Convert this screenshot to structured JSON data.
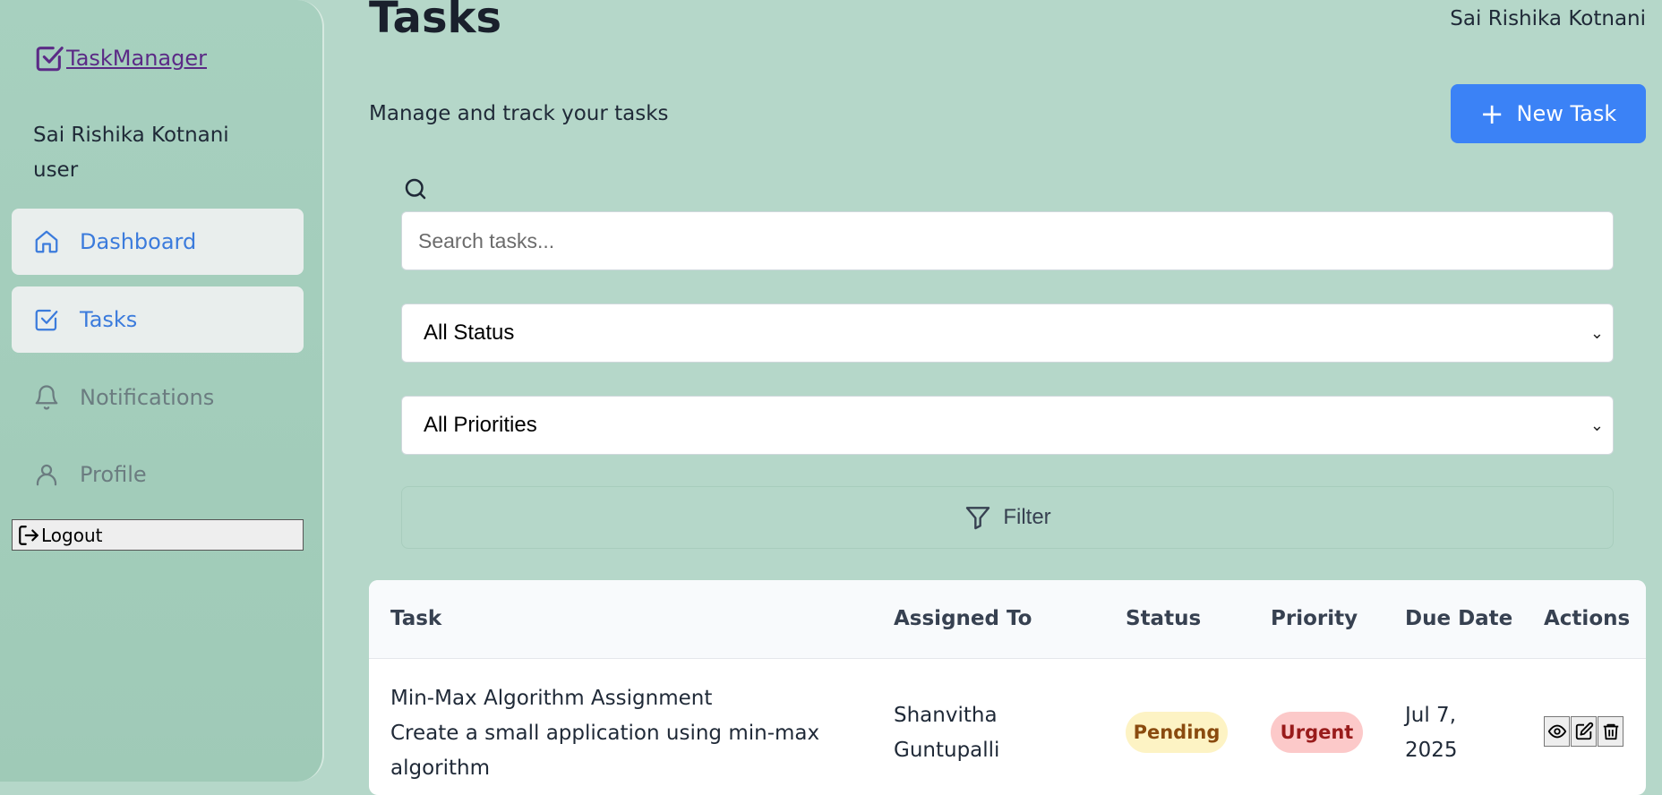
{
  "brand": {
    "name": "TaskManager"
  },
  "user": {
    "name": "Sai Rishika Kotnani",
    "role": "user"
  },
  "nav": [
    {
      "label": "Dashboard",
      "icon": "home-icon"
    },
    {
      "label": "Tasks",
      "icon": "checkbox-icon"
    },
    {
      "label": "Notifications",
      "icon": "bell-icon"
    },
    {
      "label": "Profile",
      "icon": "user-icon"
    }
  ],
  "logout": {
    "label": "Logout"
  },
  "header": {
    "title": "Tasks",
    "user_name": "Sai Rishika Kotnani",
    "subtitle": "Manage and track your tasks",
    "new_task_label": "New Task"
  },
  "search": {
    "placeholder": "Search tasks..."
  },
  "filters": {
    "status_selected": "All Status",
    "priority_selected": "All Priorities",
    "filter_label": "Filter"
  },
  "table": {
    "columns": [
      "Task",
      "Assigned To",
      "Status",
      "Priority",
      "Due Date",
      "Actions"
    ],
    "rows": [
      {
        "title": "Min-Max Algorithm Assignment",
        "description_line1": "Create a small application using min-max",
        "description_line2": "algorithm",
        "assignee_line1": "Shanvitha",
        "assignee_line2": "Guntupalli",
        "status": "Pending",
        "priority": "Urgent",
        "due_line1": "Jul 7,",
        "due_line2": "2025"
      }
    ]
  },
  "colors": {
    "background": "#b5d7c9",
    "sidebar": "#a7d0bf",
    "accent": "#3b82f6",
    "pending_bg": "#fdf3c4",
    "urgent_bg": "#fcc9c9"
  }
}
